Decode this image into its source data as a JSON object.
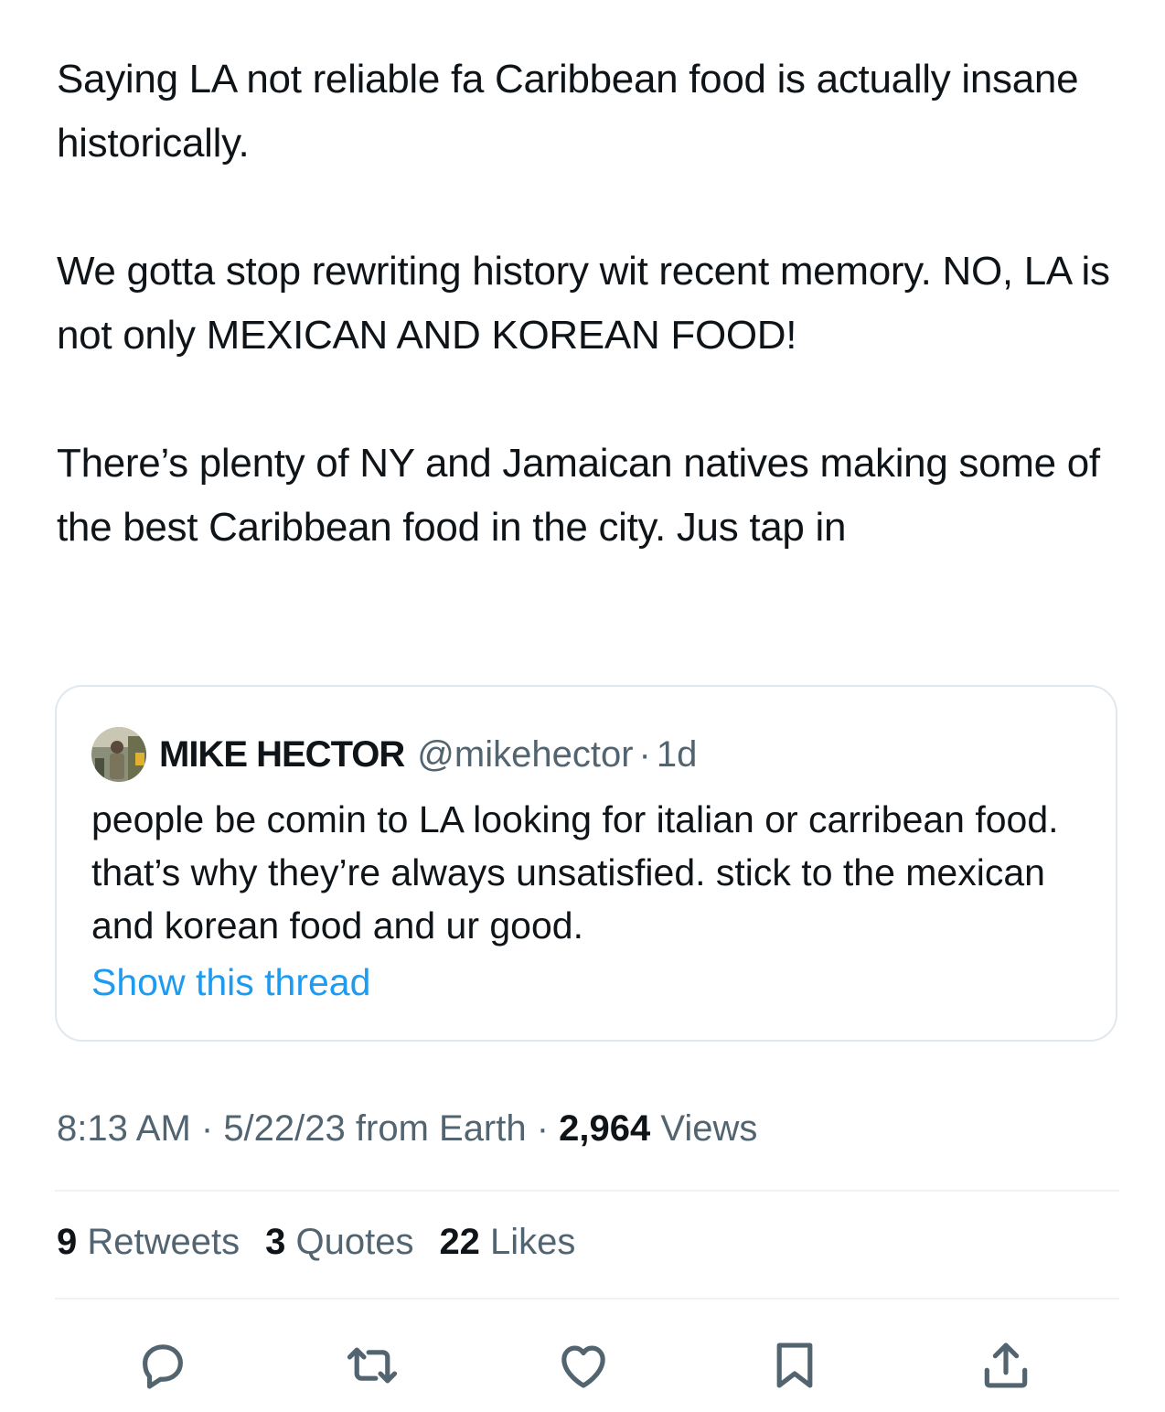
{
  "tweet": {
    "paragraphs": [
      "Saying LA not reliable fa Caribbean food is actually insane historically.",
      "We gotta stop rewriting history wit recent memory. NO, LA is not only MEXICAN AND KOREAN FOOD!",
      "There’s plenty of NY and Jamaican natives making some of the best Caribbean food in the city. Jus tap in"
    ]
  },
  "quote": {
    "name": "MIKE HECTOR",
    "handle": "@mikehector",
    "separator": "·",
    "time": "1d",
    "text": "people be comin to LA looking for italian or carribean food. that’s why they’re always unsatisfied. stick to the mexican and korean food and ur good.",
    "show_thread": "Show this thread",
    "avatar_icon": "user-avatar-photo"
  },
  "meta": {
    "time": "8:13 AM",
    "sep1": " · ",
    "date": "5/22/23",
    "source": " from Earth",
    "sep2": " · ",
    "views_count": "2,964",
    "views_label": " Views"
  },
  "stats": {
    "retweets_count": "9",
    "retweets_label": " Retweets",
    "quotes_count": "3",
    "quotes_label": " Quotes",
    "likes_count": "22",
    "likes_label": " Likes"
  },
  "actions": {
    "icons": [
      "reply-icon",
      "retweet-icon",
      "like-icon",
      "bookmark-icon",
      "share-icon"
    ],
    "icon_color": "#536471"
  },
  "colors": {
    "text": "#0f1419",
    "secondary": "#536471",
    "link": "#1d9bf0",
    "border": "#e1e8ed"
  }
}
